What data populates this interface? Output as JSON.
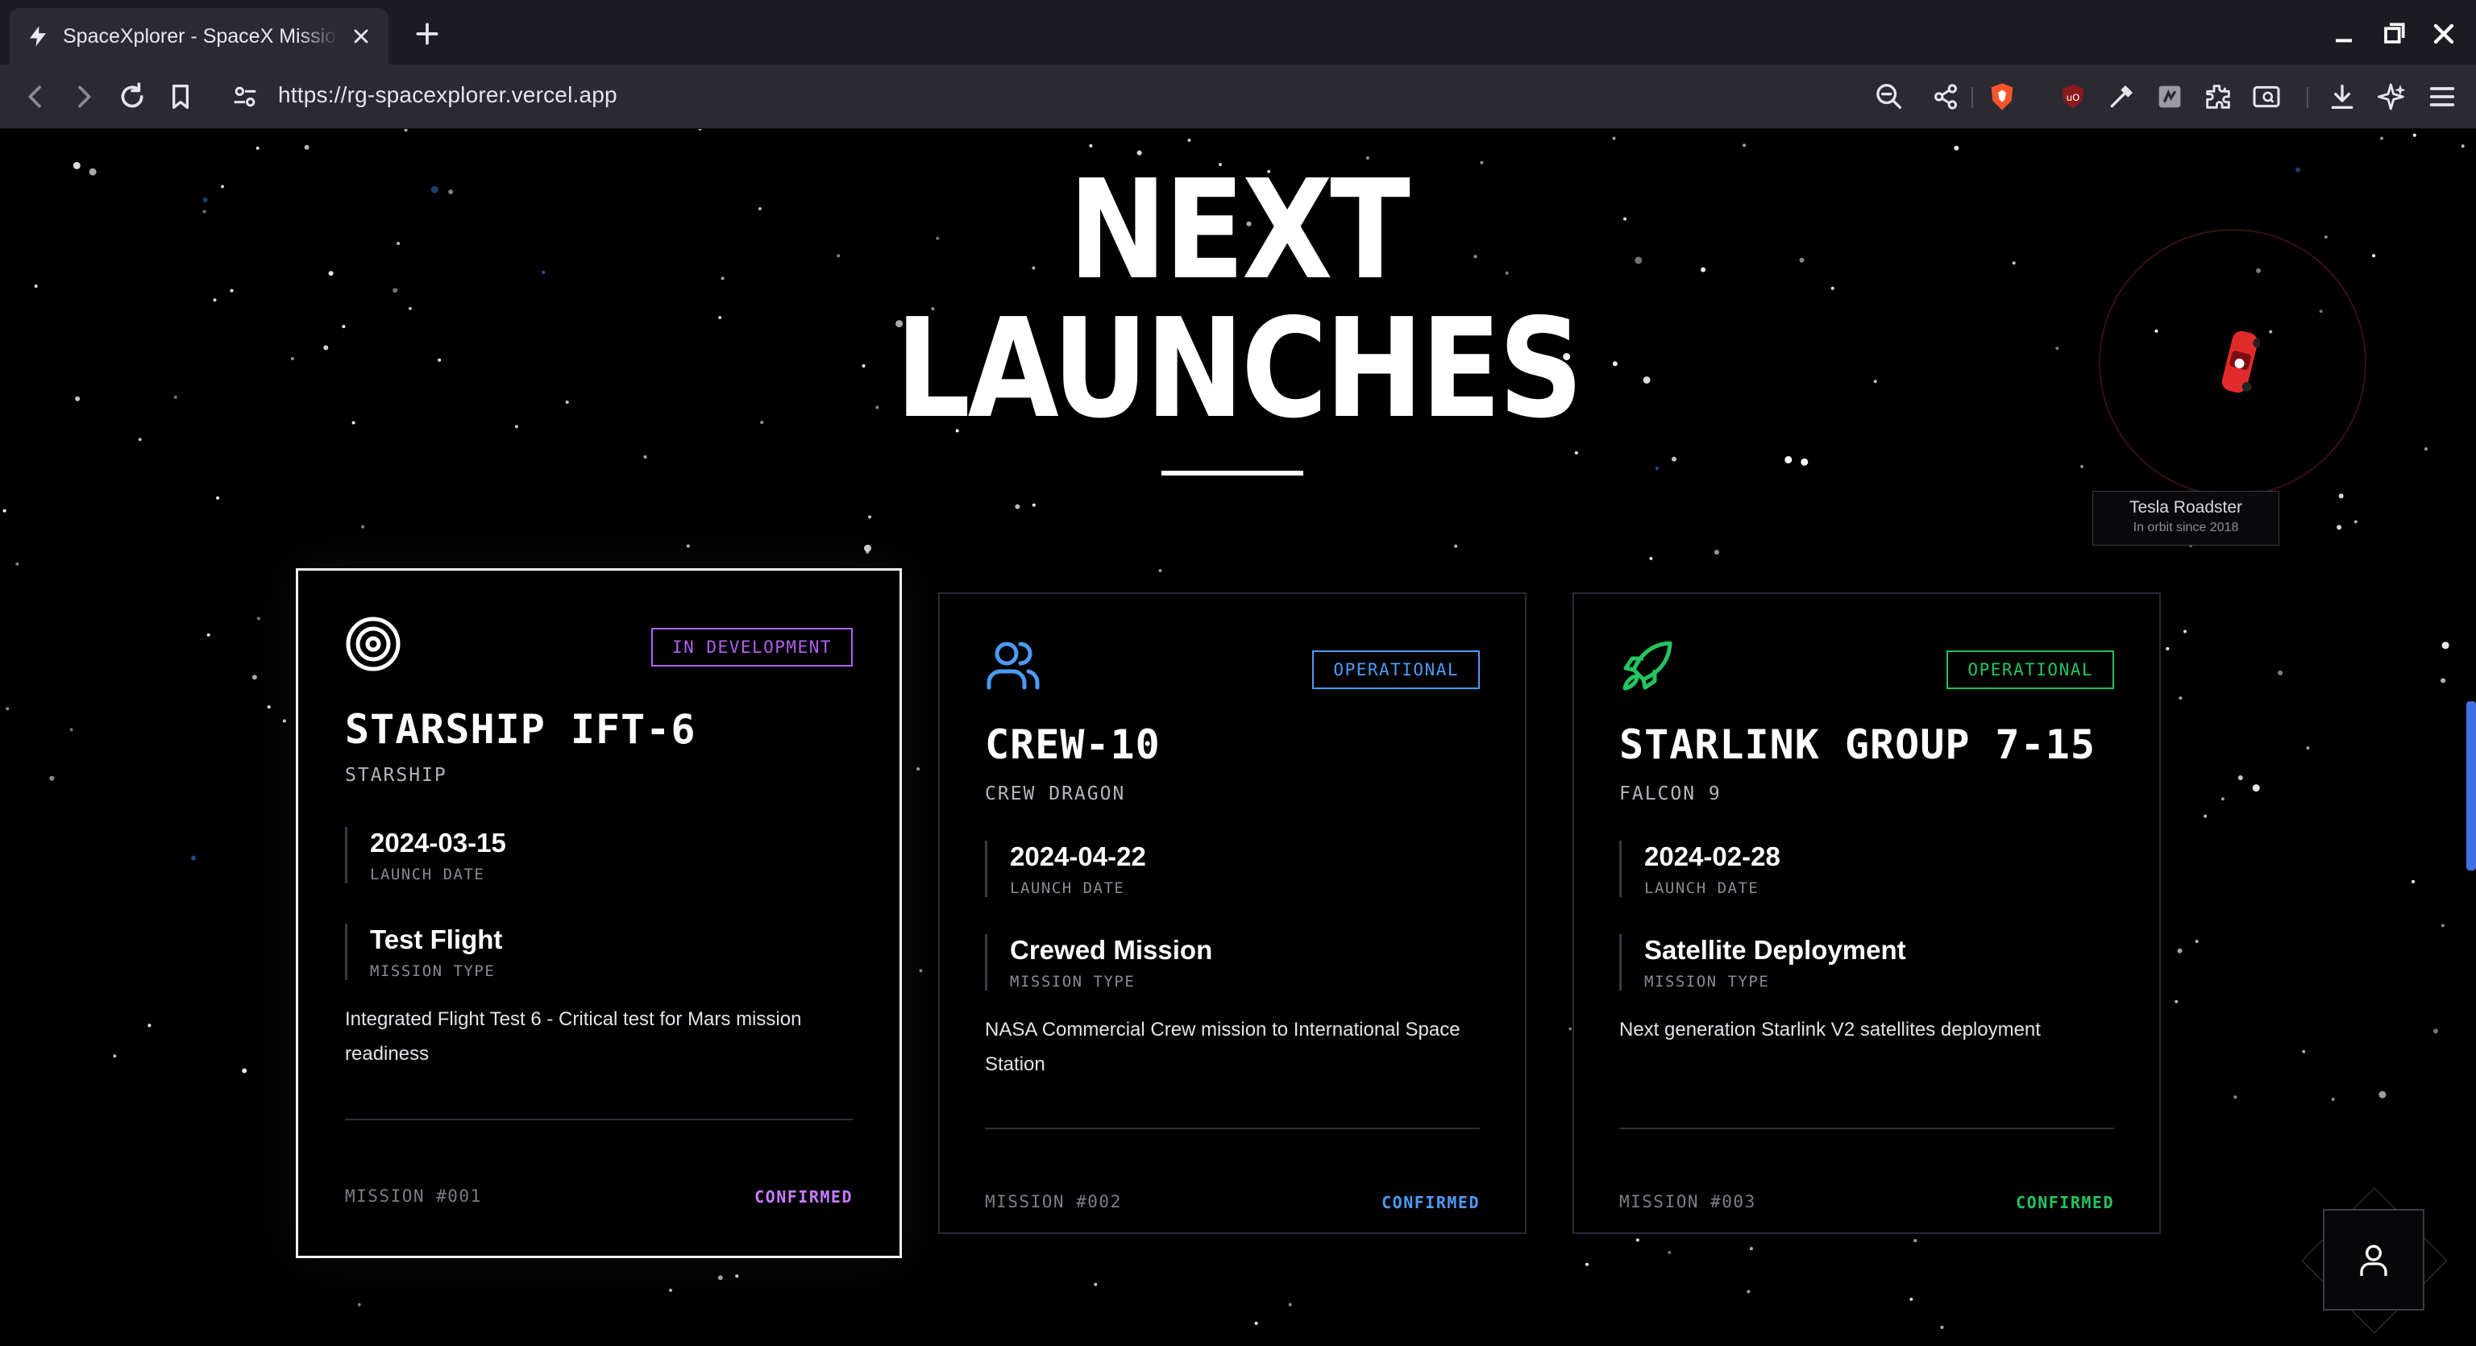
{
  "browser": {
    "tab_title": "SpaceXplorer - SpaceX Mission Tracker",
    "url": "https://rg-spacexplorer.vercel.app"
  },
  "hero": {
    "title_line1": "NEXT",
    "title_line2": "LAUNCHES"
  },
  "launches": [
    {
      "icon": "target-icon",
      "badge": "IN DEVELOPMENT",
      "badge_color": "#b25ff0",
      "name": "STARSHIP IFT-6",
      "vehicle": "STARSHIP",
      "date": "2024-03-15",
      "date_label": "LAUNCH DATE",
      "mission_type": "Test Flight",
      "mission_type_label": "MISSION TYPE",
      "description": "Integrated Flight Test 6 - Critical test for Mars mission readiness",
      "mission_no": "MISSION #001",
      "status": "CONFIRMED",
      "status_color": "#c77dff"
    },
    {
      "icon": "users-icon",
      "badge": "OPERATIONAL",
      "badge_color": "#4c9bf5",
      "name": "CREW-10",
      "vehicle": "CREW DRAGON",
      "date": "2024-04-22",
      "date_label": "LAUNCH DATE",
      "mission_type": "Crewed Mission",
      "mission_type_label": "MISSION TYPE",
      "description": "NASA Commercial Crew mission to International Space Station",
      "mission_no": "MISSION #002",
      "status": "CONFIRMED",
      "status_color": "#4c9bf5"
    },
    {
      "icon": "rocket-icon",
      "badge": "OPERATIONAL",
      "badge_color": "#22c55e",
      "name": "STARLINK GROUP 7-15",
      "vehicle": "FALCON 9",
      "date": "2024-02-28",
      "date_label": "LAUNCH DATE",
      "mission_type": "Satellite Deployment",
      "mission_type_label": "MISSION TYPE",
      "description": "Next generation Starlink V2 satellites deployment",
      "mission_no": "MISSION #003",
      "status": "CONFIRMED",
      "status_color": "#22c55e"
    }
  ],
  "roadster": {
    "title": "Tesla Roadster",
    "subtitle": "In orbit since 2018"
  }
}
